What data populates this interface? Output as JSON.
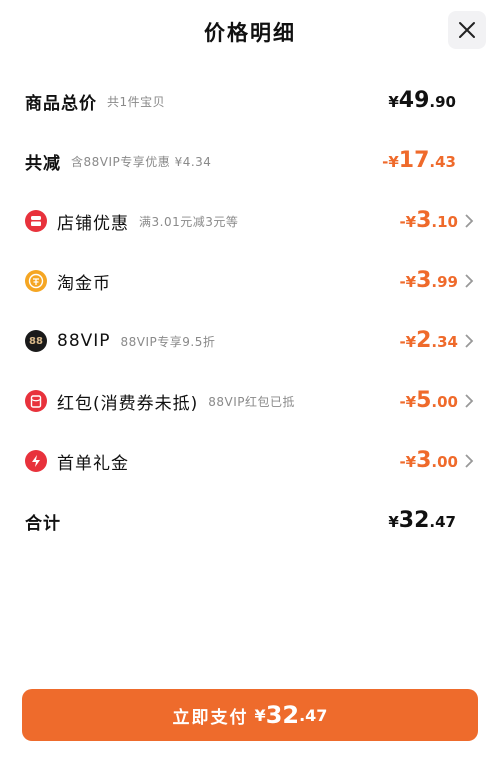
{
  "title": "价格明细",
  "rows": {
    "total": {
      "label": "商品总价",
      "note": "共1件宝贝",
      "currency": "¥",
      "int": "49",
      "dec": ".90"
    },
    "reduce": {
      "label": "共减",
      "note": "含88VIP专享优惠 ¥4.34",
      "currency": "-¥",
      "int": "17",
      "dec": ".43"
    },
    "store": {
      "label": "店铺优惠",
      "note": "满3.01元减3元等",
      "currency": "-¥",
      "int": "3",
      "dec": ".10",
      "icon": "store-icon"
    },
    "coin": {
      "label": "淘金币",
      "note": "",
      "currency": "-¥",
      "int": "3",
      "dec": ".99",
      "icon": "coin-icon"
    },
    "vip": {
      "label": "88VIP",
      "note": "88VIP专享9.5折",
      "currency": "-¥",
      "int": "2",
      "dec": ".34",
      "icon": "88vip-icon",
      "icon_text": "88"
    },
    "redpacket": {
      "label": "红包(消费券未抵)",
      "note": "88VIP红包已抵",
      "currency": "-¥",
      "int": "5",
      "dec": ".00",
      "icon": "red-packet-icon"
    },
    "firstorder": {
      "label": "首单礼金",
      "note": "",
      "currency": "-¥",
      "int": "3",
      "dec": ".00",
      "icon": "lightning-icon"
    },
    "sum": {
      "label": "合计",
      "currency": "¥",
      "int": "32",
      "dec": ".47"
    }
  },
  "pay": {
    "label": "立即支付",
    "currency": "¥",
    "int": "32",
    "dec": ".47"
  },
  "colors": {
    "accent": "#ee6b2c",
    "discount": "#ef6a2b",
    "store_icon": "#e8323c",
    "coin_icon": "#f5a623",
    "vip_icon": "#1a1a1a"
  }
}
